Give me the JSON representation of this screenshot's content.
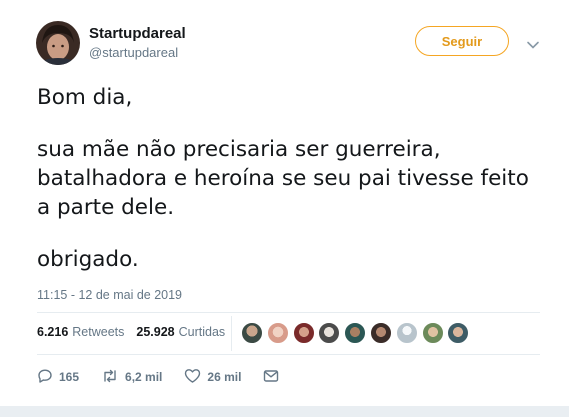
{
  "author": {
    "display_name": "Startupdareal",
    "handle": "@startupdareal"
  },
  "follow_button": {
    "label": "Seguir"
  },
  "tweet": {
    "paragraphs": [
      "Bom dia,",
      "sua mãe não precisaria ser guerreira,\nbatalhadora e heroína se seu pai tivesse feito\na parte dele.",
      "obrigado."
    ],
    "timestamp": "11:15 - 12 de mai de 2019"
  },
  "stats": {
    "retweets_count": "6.216",
    "retweets_label": "Retweets",
    "likes_count": "25.928",
    "likes_label": "Curtidas"
  },
  "actions": {
    "reply_count": "165",
    "retweet_count": "6,2 mil",
    "like_count": "26 mil"
  },
  "colors": {
    "follow_accent": "#f5a623",
    "muted_text": "#657786",
    "primary_text": "#14171a"
  },
  "icons": [
    "chevron-down-icon",
    "reply-icon",
    "retweet-icon",
    "like-icon",
    "message-icon"
  ]
}
